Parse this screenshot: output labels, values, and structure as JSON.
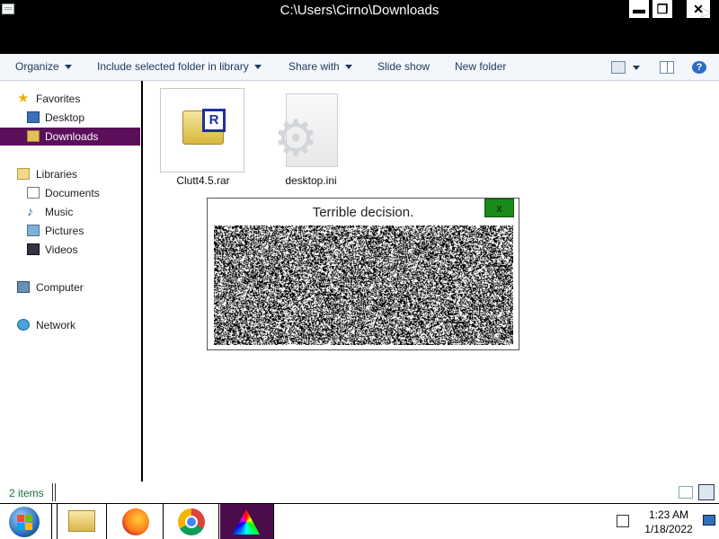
{
  "window": {
    "title": "C:\\Users\\Cirno\\Downloads",
    "min_glyph": "▬",
    "max_glyph": "❐",
    "close_glyph": "✕"
  },
  "toolbar": {
    "organize": "Organize",
    "include": "Include selected folder in library",
    "share": "Share with",
    "slideshow": "Slide show",
    "new_folder": "New folder",
    "help_glyph": "?"
  },
  "nav": {
    "favorites": "Favorites",
    "desktop": "Desktop",
    "downloads": "Downloads",
    "libraries": "Libraries",
    "documents": "Documents",
    "music": "Music",
    "pictures": "Pictures",
    "videos": "Videos",
    "computer": "Computer",
    "network": "Network"
  },
  "files": [
    {
      "name": "Clutt4.5.rar",
      "badge": "R"
    },
    {
      "name": "desktop.ini"
    }
  ],
  "dialog": {
    "title": "Terrible decision.",
    "close_glyph": "x"
  },
  "status": {
    "items": "2 items"
  },
  "tray": {
    "time": "1:23 AM",
    "date": "1/18/2022"
  }
}
